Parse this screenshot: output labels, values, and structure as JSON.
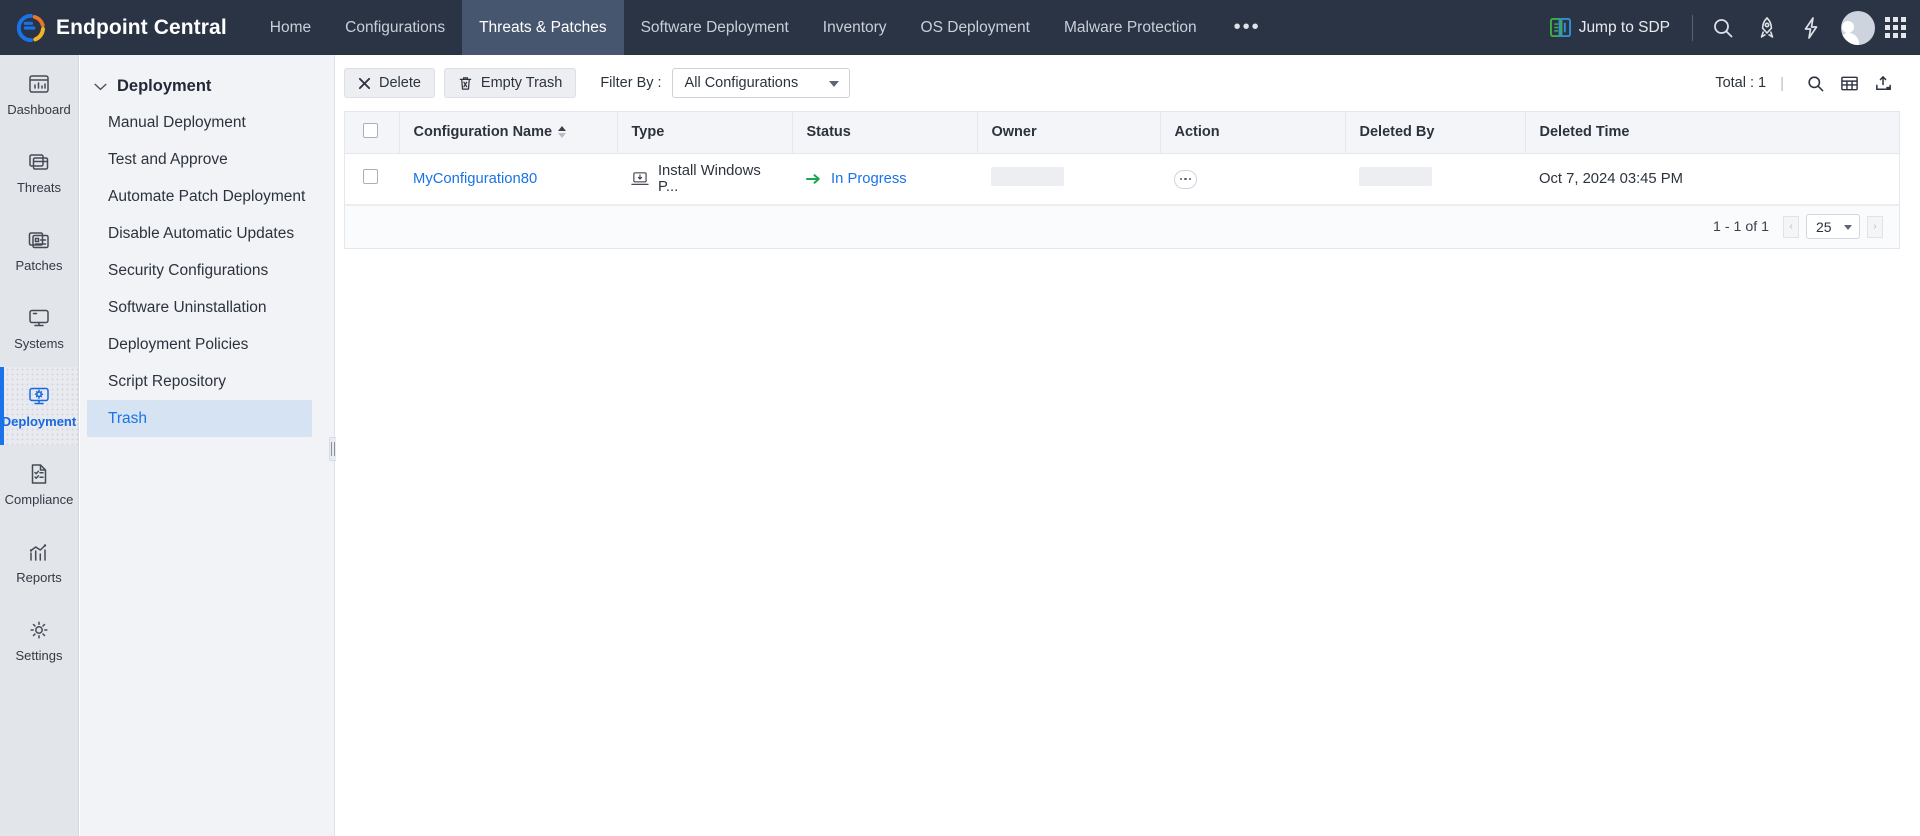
{
  "app": {
    "brand": "Endpoint Central",
    "logo_icon": "endpoint-central-logo"
  },
  "topnav": {
    "items": [
      {
        "label": "Home",
        "active": false
      },
      {
        "label": "Configurations",
        "active": false
      },
      {
        "label": "Threats & Patches",
        "active": true
      },
      {
        "label": "Software Deployment",
        "active": false
      },
      {
        "label": "Inventory",
        "active": false
      },
      {
        "label": "OS Deployment",
        "active": false
      },
      {
        "label": "Malware Protection",
        "active": false
      }
    ],
    "more_label": "•••",
    "jump_to_sdp": "Jump to SDP",
    "jump_icon": "sdp-icon",
    "icons": [
      {
        "name": "search-icon"
      },
      {
        "name": "rocket-icon"
      },
      {
        "name": "lightning-icon"
      },
      {
        "name": "avatar"
      },
      {
        "name": "apps-grid-icon"
      }
    ]
  },
  "rail": {
    "items": [
      {
        "label": "Dashboard",
        "icon": "dashboard-chart-icon",
        "active": false
      },
      {
        "label": "Threats",
        "icon": "threats-window-icon",
        "active": false
      },
      {
        "label": "Patches",
        "icon": "patches-list-icon",
        "active": false
      },
      {
        "label": "Systems",
        "icon": "systems-monitor-icon",
        "active": false
      },
      {
        "label": "Deployment",
        "icon": "deployment-gear-monitor-icon",
        "active": true
      },
      {
        "label": "Compliance",
        "icon": "compliance-document-icon",
        "active": false
      },
      {
        "label": "Reports",
        "icon": "reports-bars-icon",
        "active": false
      },
      {
        "label": "Settings",
        "icon": "settings-gear-icon",
        "active": false
      }
    ]
  },
  "subnav": {
    "header": "Deployment",
    "items": [
      {
        "label": "Manual Deployment",
        "active": false
      },
      {
        "label": "Test and Approve",
        "active": false
      },
      {
        "label": "Automate Patch Deployment",
        "active": false
      },
      {
        "label": "Disable Automatic Updates",
        "active": false
      },
      {
        "label": "Security Configurations",
        "active": false
      },
      {
        "label": "Software Uninstallation",
        "active": false
      },
      {
        "label": "Deployment Policies",
        "active": false
      },
      {
        "label": "Script Repository",
        "active": false
      },
      {
        "label": "Trash",
        "active": true
      }
    ]
  },
  "toolbar": {
    "delete_label": "Delete",
    "empty_trash_label": "Empty Trash",
    "filter_label": "Filter By :",
    "filter_value": "All Configurations",
    "total_label": "Total : 1",
    "separator": "|",
    "icons": [
      {
        "name": "search-icon"
      },
      {
        "name": "table-columns-icon"
      },
      {
        "name": "export-upload-icon"
      }
    ]
  },
  "table": {
    "columns": [
      {
        "key": "checkbox",
        "label": ""
      },
      {
        "key": "name",
        "label": "Configuration Name",
        "sortable": true
      },
      {
        "key": "type",
        "label": "Type"
      },
      {
        "key": "status",
        "label": "Status"
      },
      {
        "key": "owner",
        "label": "Owner"
      },
      {
        "key": "action",
        "label": "Action"
      },
      {
        "key": "deletedby",
        "label": "Deleted By"
      },
      {
        "key": "deltime",
        "label": "Deleted Time"
      }
    ],
    "rows": [
      {
        "name": "MyConfiguration80",
        "type": "Install Windows P...",
        "type_icon": "install-laptop-icon",
        "status": "In Progress",
        "status_icon": "arrow-right-green-icon",
        "owner": "",
        "action_icon": "more-actions-icon",
        "deleted_by": "",
        "deleted_time": "Oct 7, 2024 03:45 PM"
      }
    ]
  },
  "pagination": {
    "range": "1 - 1 of 1",
    "page_size": "25",
    "prev": "‹",
    "next": "›"
  },
  "colors": {
    "topbar": "#2b3445",
    "accent": "#1a73e8",
    "active_tab": "#46566e",
    "rail_bg": "#e2e5ea",
    "subnav_bg": "#f1f3f7",
    "status_green": "#19a84c"
  }
}
